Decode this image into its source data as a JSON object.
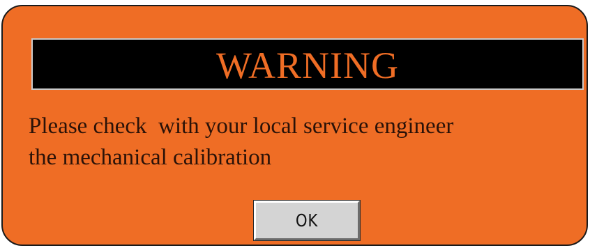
{
  "dialog": {
    "title": "WARNING",
    "message_line1": "Please check  with your local service engineer",
    "message_line2": "the mechanical calibration",
    "ok_label": "OK"
  },
  "colors": {
    "background": "#ef6d25",
    "title_bar": "#000000",
    "title_text": "#ef6d25",
    "button": "#d4d4d4"
  }
}
